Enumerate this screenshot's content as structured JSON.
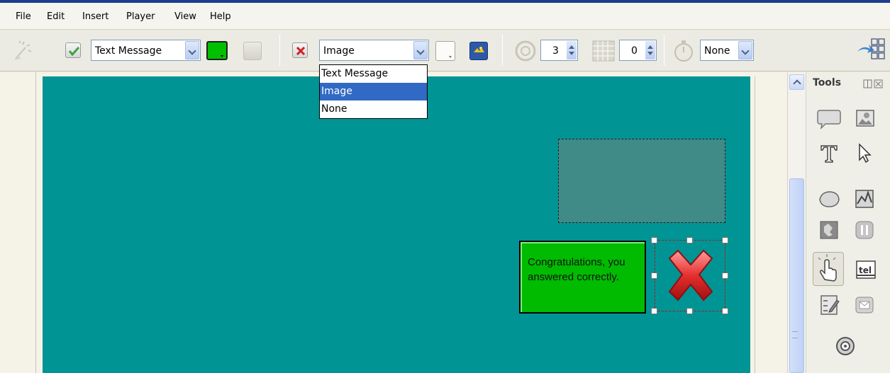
{
  "menu": [
    "File",
    "Edit",
    "Insert",
    "Player",
    "View",
    "Help"
  ],
  "toolbar": {
    "success_type_value": "Text Message",
    "failure_type_value": "Image",
    "attempts_value": "3",
    "pause_value": "0",
    "timer_value": "None"
  },
  "dropdown_options": [
    "Text Message",
    "Image",
    "None"
  ],
  "dropdown_selected_index": 1,
  "canvas": {
    "success_message": "Congratulations, you answered correctly."
  },
  "tools_panel": {
    "title": "Tools",
    "items": [
      "speech-bubble-icon",
      "image-icon",
      "text-icon",
      "pointer-icon",
      "shape-icon",
      "chart-icon",
      "puzzle-icon",
      "pause-icon",
      "hand-icon",
      "tel-icon",
      "checklist-icon",
      "email-icon",
      "spiral-icon"
    ]
  },
  "colors": {
    "canvas_bg": "#009494",
    "drop_zone_bg": "#408a88",
    "message_bg": "#00bb00",
    "selection_highlight": "#316ac5"
  }
}
